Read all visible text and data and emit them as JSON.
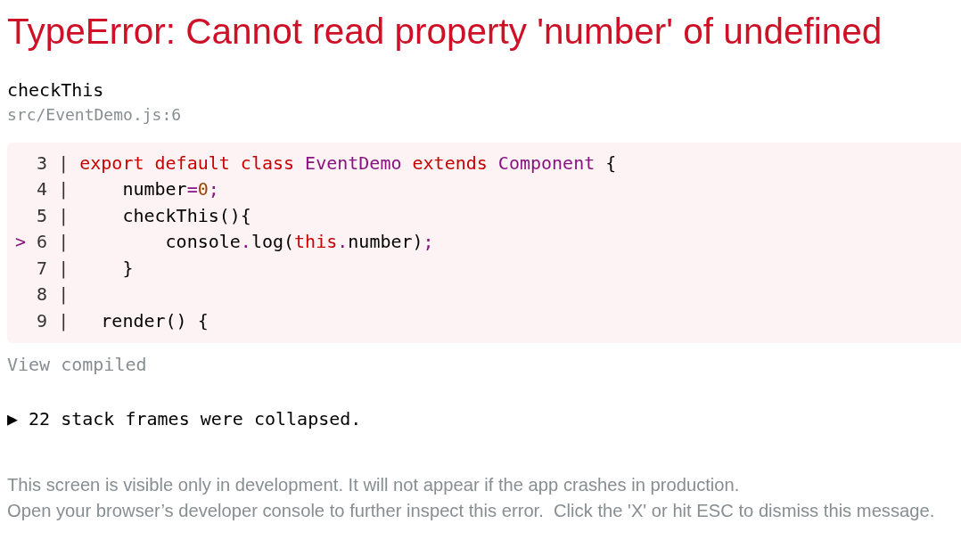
{
  "error": {
    "title": "TypeError: Cannot read property 'number' of undefined",
    "function": "checkThis",
    "location": "src/EventDemo.js:6"
  },
  "code": {
    "lines": [
      {
        "number": "3",
        "separator": "|",
        "tokens": [
          {
            "text": "export default class ",
            "kind": "keyword"
          },
          {
            "text": "EventDemo ",
            "kind": "name"
          },
          {
            "text": "extends ",
            "kind": "keyword"
          },
          {
            "text": "Component ",
            "kind": "name"
          },
          {
            "text": "{",
            "kind": "plain"
          }
        ]
      },
      {
        "number": "4",
        "separator": "|",
        "tokens": [
          {
            "text": "    number",
            "kind": "plain"
          },
          {
            "text": "=",
            "kind": "punctuation"
          },
          {
            "text": "0",
            "kind": "number"
          },
          {
            "text": ";",
            "kind": "punctuation"
          }
        ]
      },
      {
        "number": "5",
        "separator": "|",
        "tokens": [
          {
            "text": "    checkThis(){",
            "kind": "plain"
          }
        ]
      },
      {
        "marker": ">",
        "number": "6",
        "separator": "|",
        "tokens": [
          {
            "text": "        console",
            "kind": "plain"
          },
          {
            "text": ".",
            "kind": "punctuation"
          },
          {
            "text": "log(",
            "kind": "plain"
          },
          {
            "text": "this",
            "kind": "keyword"
          },
          {
            "text": ".",
            "kind": "punctuation"
          },
          {
            "text": "number)",
            "kind": "plain"
          },
          {
            "text": ";",
            "kind": "punctuation"
          }
        ]
      },
      {
        "number": "7",
        "separator": "|",
        "tokens": [
          {
            "text": "    }",
            "kind": "plain"
          }
        ]
      },
      {
        "number": "8",
        "separator": "|"
      },
      {
        "number": "9",
        "separator": "|",
        "tokens": [
          {
            "text": "  render() {",
            "kind": "plain"
          }
        ]
      }
    ]
  },
  "view_compiled": "View compiled",
  "stack_frames": {
    "toggle": "▶",
    "label": "22 stack frames were collapsed."
  },
  "footer": [
    "This screen is visible only in development. It will not appear if the app crashes in production.",
    "Open your browser’s developer console to further inspect this error.  Click the 'X' or hit ESC to dismiss this message."
  ]
}
